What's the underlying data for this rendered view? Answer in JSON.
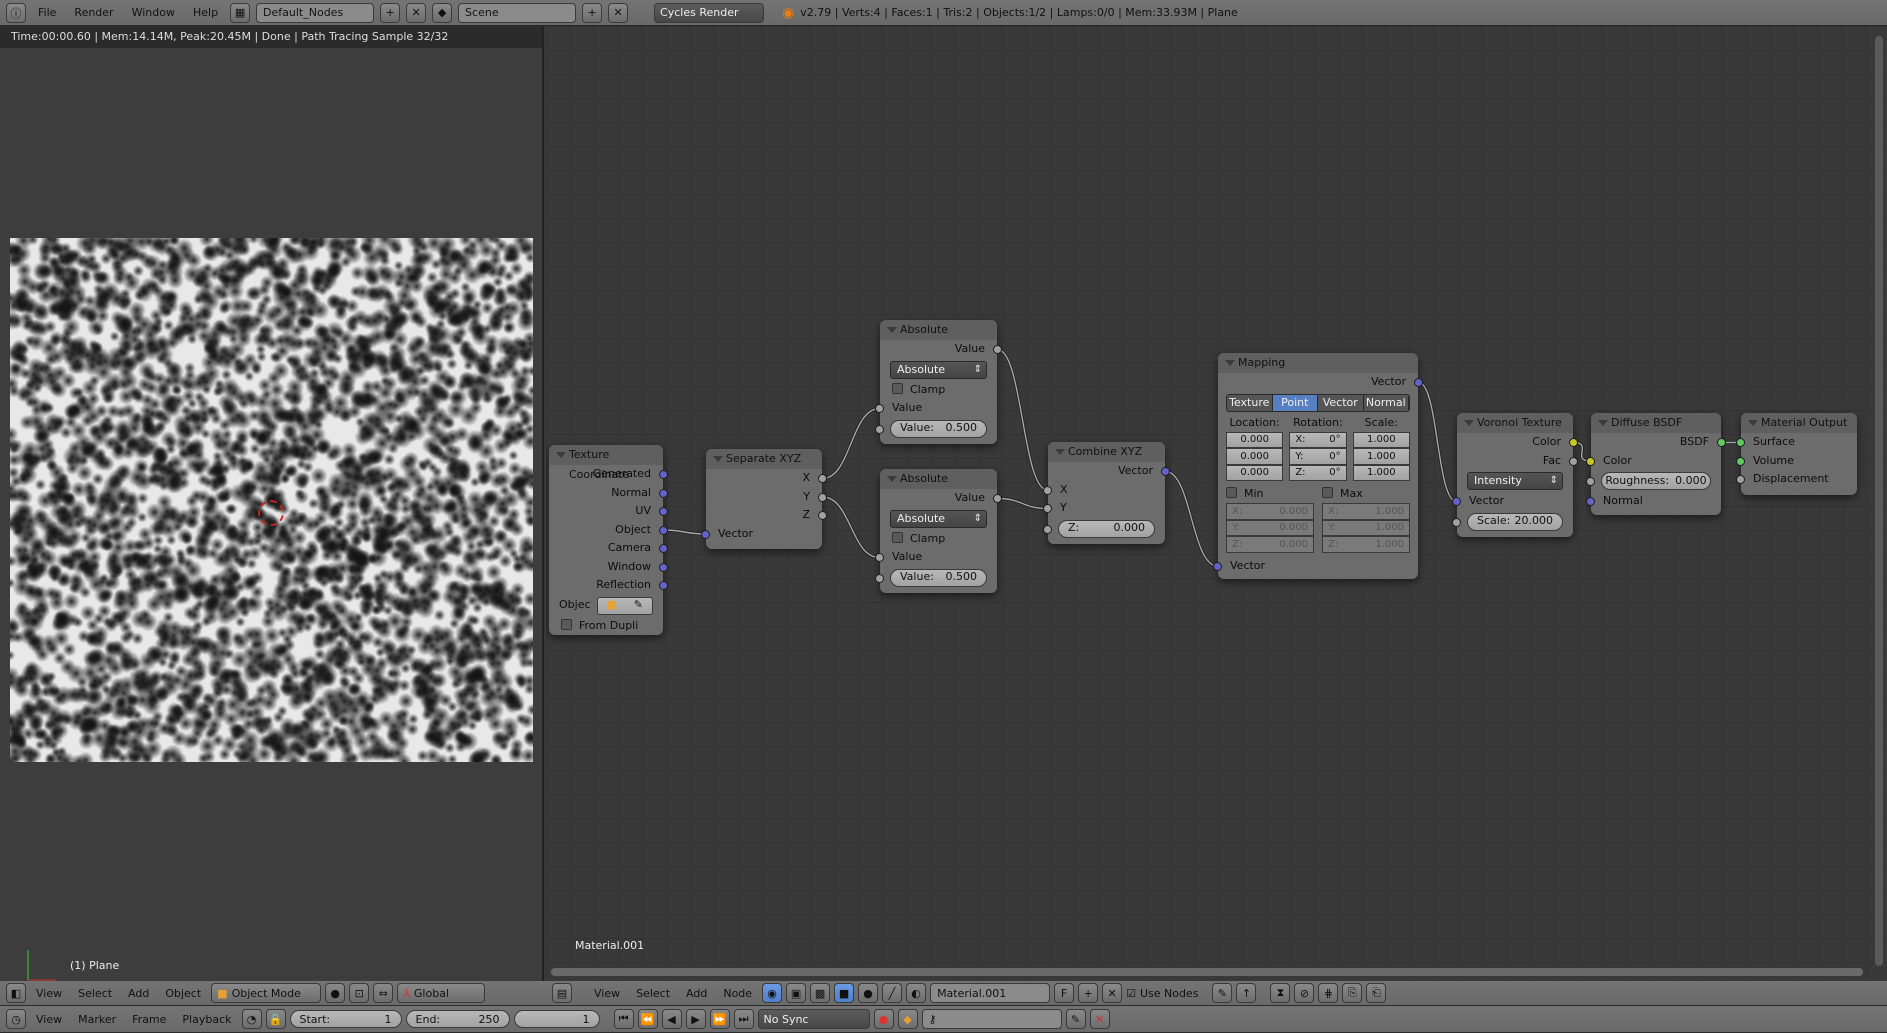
{
  "topbar": {
    "menus": [
      "File",
      "Render",
      "Window",
      "Help"
    ],
    "layout": "Default_Nodes",
    "scene": "Scene",
    "engine": "Cycles Render",
    "stats": "v2.79 | Verts:4 | Faces:1 | Tris:2 | Objects:1/2 | Lamps:0/0 | Mem:33.93M | Plane"
  },
  "viewport": {
    "render_info": "Time:00:00.60 | Mem:14.14M, Peak:20.45M | Done | Path Tracing Sample 32/32",
    "object_label": "(1) Plane",
    "header": {
      "menus": [
        "View",
        "Select",
        "Add",
        "Object"
      ],
      "mode": "Object Mode",
      "orientation": "Global"
    }
  },
  "node_editor": {
    "material_label": "Material.001",
    "header": {
      "menus": [
        "View",
        "Select",
        "Add",
        "Node"
      ],
      "material": "Material.001",
      "fake_user": "F",
      "use_nodes_label": "Use Nodes",
      "use_nodes": true
    }
  },
  "timeline": {
    "menus": [
      "View",
      "Marker",
      "Frame",
      "Playback"
    ],
    "start_label": "Start:",
    "start": "1",
    "end_label": "End:",
    "end": "250",
    "current": "1",
    "sync": "No Sync"
  },
  "nodes": {
    "texcoord": {
      "title": "Texture Coordinate",
      "outputs": [
        "Generated",
        "Normal",
        "UV",
        "Object",
        "Camera",
        "Window",
        "Reflection"
      ],
      "object_label": "Objec",
      "from_dupli": "From Dupli"
    },
    "sepxyz": {
      "title": "Separate XYZ",
      "outputs": [
        "X",
        "Y",
        "Z"
      ],
      "input": "Vector"
    },
    "abs1": {
      "title": "Absolute",
      "output": "Value",
      "op": "Absolute",
      "clamp": "Clamp",
      "input": "Value",
      "value_label": "Value:",
      "value": "0.500"
    },
    "abs2": {
      "title": "Absolute",
      "output": "Value",
      "op": "Absolute",
      "clamp": "Clamp",
      "input": "Value",
      "value_label": "Value:",
      "value": "0.500"
    },
    "combine": {
      "title": "Combine XYZ",
      "output": "Vector",
      "inputs": [
        "X",
        "Y"
      ],
      "z_label": "Z:",
      "z": "0.000"
    },
    "mapping": {
      "title": "Mapping",
      "output": "Vector",
      "tabs": [
        "Texture",
        "Point",
        "Vector",
        "Normal"
      ],
      "selected_tab": "Point",
      "col_labels": [
        "Location:",
        "Rotation:",
        "Scale:"
      ],
      "location": [
        "0.000",
        "0.000",
        "0.000"
      ],
      "rotation": [
        [
          "X:",
          "0°"
        ],
        [
          "Y:",
          "0°"
        ],
        [
          "Z:",
          "0°"
        ]
      ],
      "scale": [
        "1.000",
        "1.000",
        "1.000"
      ],
      "min_label": "Min",
      "max_label": "Max",
      "min": [
        [
          "X:",
          "0.000"
        ],
        [
          "Y:",
          "0.000"
        ],
        [
          "Z:",
          "0.000"
        ]
      ],
      "max": [
        [
          "X:",
          "1.000"
        ],
        [
          "Y:",
          "1.000"
        ],
        [
          "Z:",
          "1.000"
        ]
      ],
      "input": "Vector"
    },
    "voronoi": {
      "title": "Voronoi Texture",
      "outputs": [
        "Color",
        "Fac"
      ],
      "coloring": "Intensity",
      "input": "Vector",
      "scale_label": "Scale:",
      "scale": "20.000"
    },
    "diffuse": {
      "title": "Diffuse BSDF",
      "output": "BSDF",
      "color": "Color",
      "roughness_label": "Roughness:",
      "roughness": "0.000",
      "normal": "Normal"
    },
    "output": {
      "title": "Material Output",
      "inputs": [
        "Surface",
        "Volume",
        "Displacement"
      ]
    }
  },
  "links": [
    {
      "from": "texcoord.object",
      "to": "sepxyz.vector"
    },
    {
      "from": "sepxyz.x",
      "to": "abs1.value"
    },
    {
      "from": "sepxyz.y",
      "to": "abs2.value"
    },
    {
      "from": "abs1.out",
      "to": "combine.x"
    },
    {
      "from": "abs2.out",
      "to": "combine.y"
    },
    {
      "from": "combine.out",
      "to": "mapping.in"
    },
    {
      "from": "mapping.out",
      "to": "voronoi.vector"
    },
    {
      "from": "voronoi.color",
      "to": "diffuse.color"
    },
    {
      "from": "diffuse.bsdf",
      "to": "output.surface"
    }
  ],
  "colors": {
    "vector_socket": "#6363c7",
    "float_socket": "#a1a1a1",
    "color_socket": "#c7c729",
    "shader_socket": "#63c763",
    "selected_tab": "#5680c2"
  }
}
